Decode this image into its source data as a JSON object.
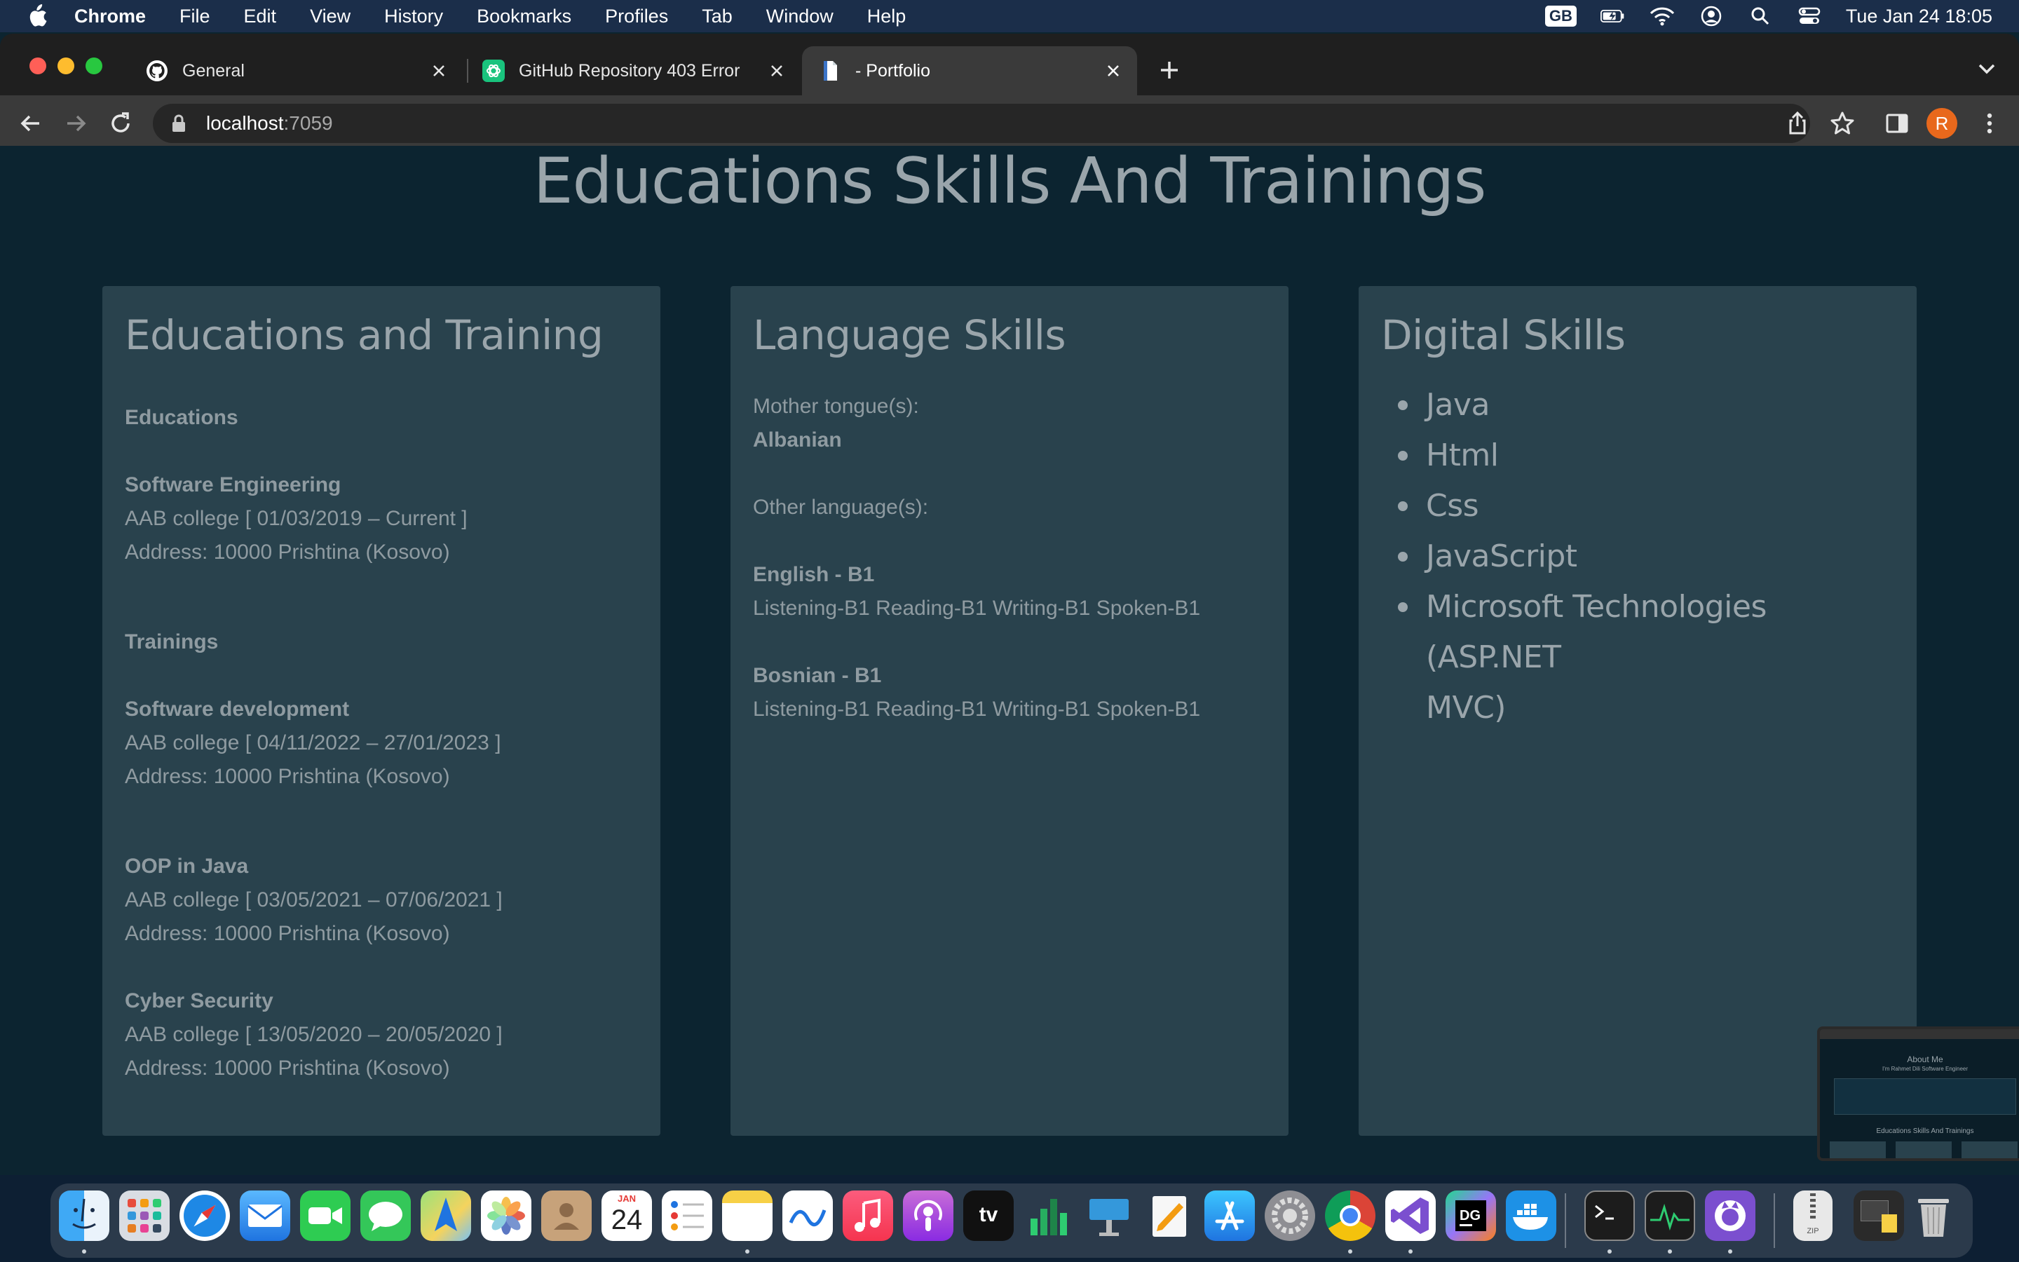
{
  "menubar": {
    "items": [
      "Chrome",
      "File",
      "Edit",
      "View",
      "History",
      "Bookmarks",
      "Profiles",
      "Tab",
      "Window",
      "Help"
    ],
    "input_source": "GB",
    "clock": "Tue Jan 24  18:05"
  },
  "tabs": [
    {
      "title": "General",
      "icon": "github-icon"
    },
    {
      "title": "GitHub Repository 403 Error",
      "icon": "chatgpt-icon"
    },
    {
      "title": "- Portfolio",
      "icon": "page-icon"
    }
  ],
  "address": {
    "host": "localhost",
    "port": ":7059"
  },
  "profile": {
    "initial": "R",
    "color": "#e8681c"
  },
  "page": {
    "section_title": "Educations Skills And Trainings",
    "education": {
      "heading": "Educations and Training",
      "sub_education": "Educations",
      "entries": [
        {
          "title": "Software Engineering",
          "line1": "AAB college [ 01/03/2019 – Current ]",
          "line2": "Address: 10000 Prishtina (Kosovo)"
        }
      ],
      "sub_trainings": "Trainings",
      "trainings": [
        {
          "title": "Software development",
          "line1": "AAB college [ 04/11/2022 – 27/01/2023 ]",
          "line2": "Address: 10000 Prishtina (Kosovo)"
        },
        {
          "title": "OOP in Java",
          "line1": "AAB college [ 03/05/2021 – 07/06/2021 ]",
          "line2": "Address: 10000 Prishtina (Kosovo)"
        },
        {
          "title": "Cyber Security",
          "line1": "AAB college [ 13/05/2020 – 20/05/2020 ]",
          "line2": "Address: 10000 Prishtina (Kosovo)"
        }
      ]
    },
    "language": {
      "heading": "Language Skills",
      "mother_label": "Mother tongue(s):",
      "mother_value": "Albanian",
      "other_label": "Other language(s):",
      "languages": [
        {
          "name": "English - B1",
          "detail": "Listening-B1 Reading-B1 Writing-B1 Spoken-B1"
        },
        {
          "name": "Bosnian - B1",
          "detail": "Listening-B1 Reading-B1 Writing-B1 Spoken-B1"
        }
      ]
    },
    "digital": {
      "heading": "Digital Skills",
      "items": [
        "Java",
        "Html",
        "Css",
        "JavaScript",
        "Microsoft Technologies (ASP.NET",
        "MVC)"
      ]
    }
  },
  "preview": {
    "title": "About Me",
    "subtitle": "I'm Rahmet Dili Software Engineer",
    "section": "Educations Skills And Trainings"
  },
  "dock": {
    "calendar_month": "JAN",
    "calendar_day": "24",
    "apps": [
      "finder-icon",
      "launchpad-icon",
      "safari-icon",
      "mail-icon",
      "facetime-icon",
      "messages-icon",
      "maps-icon",
      "photos-icon",
      "contacts-icon",
      "calendar-icon",
      "reminders-icon",
      "notes-icon",
      "freeform-icon",
      "music-icon",
      "podcasts-icon",
      "tv-icon",
      "numbers-icon",
      "keynote-icon",
      "pages-icon",
      "app-store-icon",
      "system-settings-icon",
      "chrome-icon",
      "visual-studio-icon",
      "datagrip-icon",
      "docker-icon",
      "terminal-icon",
      "activity-monitor-icon",
      "github-desktop-icon",
      "archive-icon",
      "downloads-icon",
      "trash-icon"
    ],
    "tv_label": "tv",
    "zip_label": "ZIP"
  }
}
